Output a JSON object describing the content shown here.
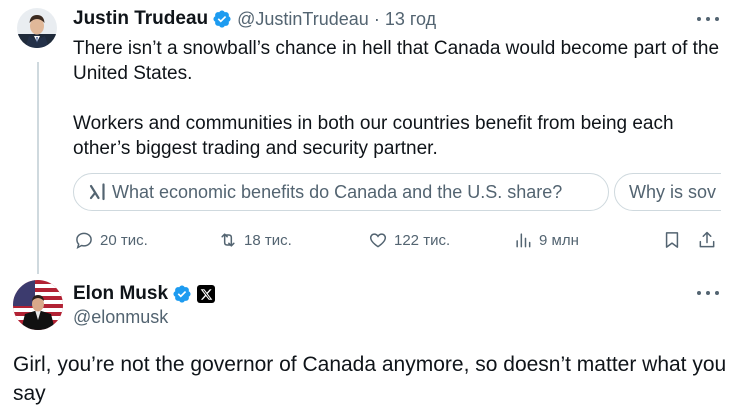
{
  "tweet1": {
    "author_name": "Justin Trudeau",
    "author_handle": "@JustinTrudeau",
    "separator": "·",
    "time_ago": "13 год",
    "text": "There isn’t a snowball’s chance in hell that Canada would become part of the United States.\n\nWorkers and communities in both our countries benefit from being each other’s biggest trading and security partner.",
    "grok_suggestions": [
      "What economic benefits do Canada and the U.S. share?",
      "Why is sov"
    ],
    "stats": {
      "replies": "20 тис.",
      "reposts": "18 тис.",
      "likes": "122 тис.",
      "views": "9 млн"
    }
  },
  "tweet2": {
    "author_name": "Elon Musk",
    "author_handle": "@elonmusk",
    "text": "Girl, you’re not the governor of Canada anymore, so doesn’t matter what you say"
  },
  "colors": {
    "text_primary": "#0f1419",
    "text_secondary": "#536471",
    "verified_blue": "#1d9bf0",
    "border": "#cfd9de"
  },
  "icons": [
    "verified-badge-icon",
    "more-options-icon",
    "grok-icon",
    "reply-icon",
    "repost-icon",
    "like-icon",
    "views-icon",
    "bookmark-icon",
    "share-icon",
    "x-logo-icon"
  ]
}
